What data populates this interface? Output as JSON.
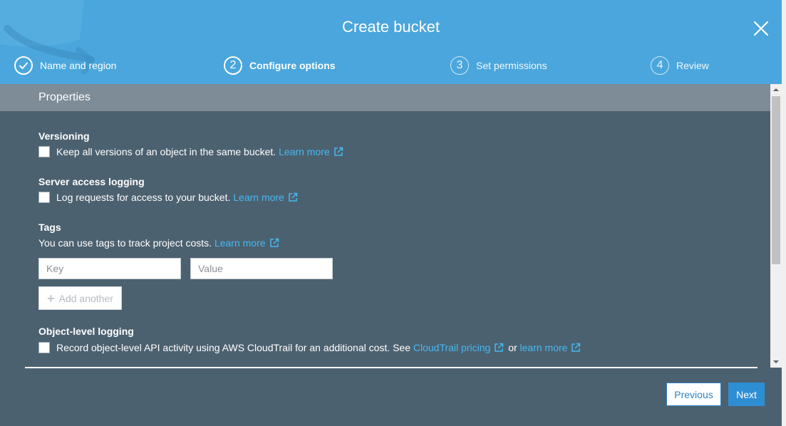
{
  "dialog": {
    "title": "Create bucket"
  },
  "steps": [
    {
      "number": "",
      "label": "Name and region",
      "state": "completed"
    },
    {
      "number": "2",
      "label": "Configure options",
      "state": "active"
    },
    {
      "number": "3",
      "label": "Set permissions",
      "state": "pending"
    },
    {
      "number": "4",
      "label": "Review",
      "state": "pending"
    }
  ],
  "properties": {
    "title": "Properties"
  },
  "versioning": {
    "title": "Versioning",
    "checkbox_label": "Keep all versions of an object in the same bucket.",
    "link": "Learn more",
    "checked": false
  },
  "access_logging": {
    "title": "Server access logging",
    "checkbox_label": "Log requests for access to your bucket.",
    "link": "Learn more",
    "checked": false
  },
  "tags": {
    "title": "Tags",
    "description": "You can use tags to track project costs.",
    "link": "Learn more",
    "key_placeholder": "Key",
    "value_placeholder": "Value",
    "add_label": "Add another"
  },
  "object_logging": {
    "title": "Object-level logging",
    "checkbox_label": "Record object-level API activity using AWS CloudTrail for an additional cost. See",
    "pricing_link": "CloudTrail pricing",
    "or_text": "or",
    "learn_link": "learn more",
    "checked": false
  },
  "footer": {
    "previous_label": "Previous",
    "next_label": "Next"
  },
  "colors": {
    "header": "#4aa6dc",
    "body": "#4c6170",
    "properties_bar": "#7d8c97",
    "link": "#44b9f2",
    "primary_button": "#2e8ed4"
  },
  "icons": [
    "close-icon",
    "check-icon",
    "external-link-icon",
    "plus-icon",
    "scroll-up-icon",
    "scroll-down-icon"
  ]
}
